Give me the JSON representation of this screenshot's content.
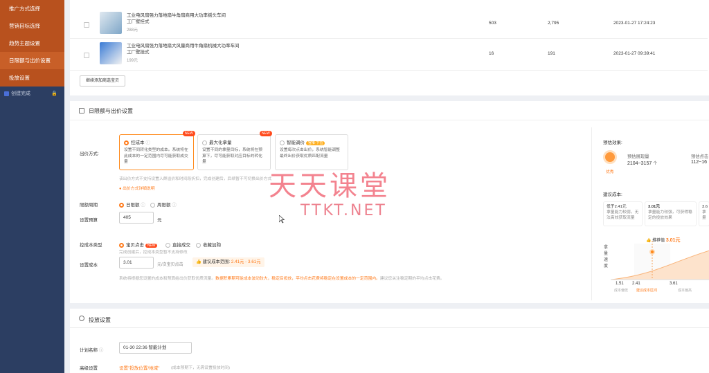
{
  "sidebar": {
    "items": [
      "推广方式选择",
      "营销目标选择",
      "趋势主题设置",
      "日限额与出价设置",
      "投放设置"
    ],
    "sub": "创建完成"
  },
  "products": [
    {
      "title": "工业电风扇强力落地扇牛角扇商用大功率摇头车间",
      "subtitle": "工厂壁挂式",
      "price": "288元",
      "v1": "503",
      "v2": "2,795",
      "time": "2023-01-27 17:24:23"
    },
    {
      "title": "工业电风扇强力落地扇大风量商用牛角扇机械大功率车间",
      "subtitle": "工厂壁挂式",
      "price": "199元",
      "v1": "16",
      "v2": "191",
      "time": "2023-01-27 09:39:41"
    }
  ],
  "add_more_btn": "继续添加商选宝贝",
  "budget_section": {
    "title": "日限额与出价设置",
    "bid_method_label": "出价方式:",
    "options": [
      {
        "title": "控成本",
        "desc": "设置不同转化类型的成本。系统将在此成本的一定范围内尽可能获取成交量",
        "badge": "NEW",
        "selected": true
      },
      {
        "title": "最大化拿量",
        "desc": "设置不同的拿量目标，系统将在预算下，尽可能获取对应目标的转化量",
        "badge": "NEW",
        "selected": false
      },
      {
        "title": "智能调价",
        "desc": "设置每次点击出价，系统智能调整最终出价获取优质匹配流量",
        "badge": "官推·下拉",
        "selected": false
      }
    ],
    "bid_hint": "该出价方式不支持设置人群溢价和时间段折扣，完成创建后，后续暂不可切换出价方式",
    "bid_link": "出价方式详细说明",
    "period_label": "限额周期",
    "period_opts": [
      "日限额",
      "周限额"
    ],
    "budget_label": "设置预算",
    "budget_value": "405",
    "budget_unit": "元",
    "cost_type_label": "控成本类型",
    "cost_type_opts": [
      "宝贝点击",
      "直接成交",
      "收藏加购"
    ],
    "cost_type_badge": "NEW",
    "cost_type_hint": "完成创建后，控成本类型暂不支持修改",
    "set_cost_label": "设置成本",
    "cost_value": "3.01",
    "cost_unit": "元/次宝贝点击",
    "range_label": "建议成本范围:",
    "range_value": "2.41元 - 3.61元",
    "note_gray": "系统将根据您设置的成本和预算给出价获取优质流量。",
    "note_orange": "数据积累期可能成本波动较大，稳定后投放，平均点击花费将稳定在设置成本的一定范围内。",
    "note_gray2": "建议您关注稳定期的平均点击花费。"
  },
  "estimate": {
    "title": "预估效果:",
    "grade": "优秀",
    "col1_label": "预估展现量",
    "col1_value": "2104~3157",
    "col1_unit": "个",
    "col2_label": "预估点击",
    "col2_value": "112~16",
    "suggest_title": "建议成本:",
    "cards": [
      {
        "price": "低于2.41元",
        "desc": "拿量能力较弱，无法高效获取流量"
      },
      {
        "price": "3.01元",
        "desc": "拿量能力较强，可获得稳定的投放效果"
      },
      {
        "price": "3.6",
        "desc": "拿量"
      }
    ],
    "chart_y_label": "拿量速度",
    "recommend_label": "推荐值",
    "recommend_value": "3.01元",
    "ticks": [
      "1.51",
      "2.41",
      "3.61"
    ],
    "tick_subs": [
      "成本偏低",
      "建议成本区间",
      "成本偏高"
    ]
  },
  "launch_section": {
    "title": "投放设置",
    "plan_label": "计划名称",
    "plan_value": "01-30 22:36 智能计划",
    "adv_label": "高级设置",
    "adv_link": "设置\"投放位置/地域\"",
    "adv_hint": "(成本预期下，无需设置投放时间)"
  },
  "watermark": {
    "line1": "天天课堂",
    "line2": "TTKT.NET"
  },
  "colors": {
    "accent": "#ff7a1a",
    "sidebar": "#2c3e62",
    "sidebar_active": "#b8511e"
  }
}
